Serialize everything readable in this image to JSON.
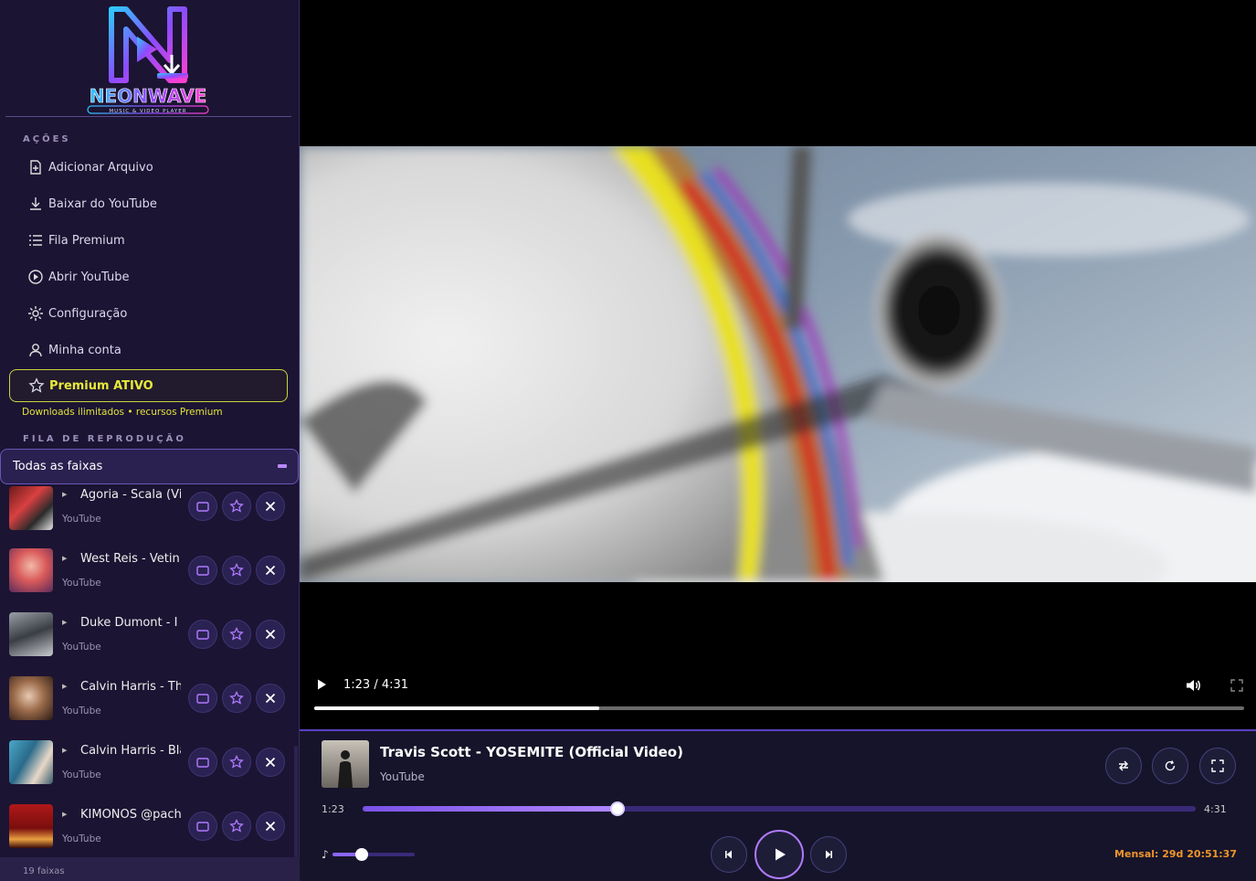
{
  "app": {
    "name": "NEONWAVE",
    "tagline": "MUSIC & VIDEO PLAYER"
  },
  "sidebar": {
    "actions_title": "AÇÕES",
    "actions": [
      {
        "label": "Adicionar Arquivo",
        "icon": "add-file-icon"
      },
      {
        "label": "Baixar do YouTube",
        "icon": "download-icon"
      },
      {
        "label": "Fila Premium",
        "icon": "list-icon"
      },
      {
        "label": "Abrir YouTube",
        "icon": "play-circle-icon"
      },
      {
        "label": "Configuração",
        "icon": "gear-icon"
      },
      {
        "label": "Minha conta",
        "icon": "user-icon"
      }
    ],
    "premium": {
      "label": "Premium ATIVO",
      "subtitle": "Downloads ilimitados • recursos Premium"
    },
    "queue_title": "FILA DE REPRODUÇÃO",
    "queue_filter": "Todas as faixas",
    "tracks": [
      {
        "title": "Agoria - Scala (Vin",
        "source": "YouTube"
      },
      {
        "title": "West Reis - Vetin",
        "source": "YouTube"
      },
      {
        "title": "Duke Dumont - I G",
        "source": "YouTube"
      },
      {
        "title": "Calvin Harris - Thir",
        "source": "YouTube"
      },
      {
        "title": "Calvin Harris - Blar",
        "source": "YouTube"
      },
      {
        "title": "KIMONOS @pacha",
        "source": "YouTube"
      }
    ],
    "track_count": "19 faixas"
  },
  "video": {
    "time": "1:23 / 4:31",
    "progress": 0.306
  },
  "player": {
    "title": "Travis Scott - YOSEMITE (Official Video)",
    "source": "YouTube",
    "current": "1:23",
    "total": "4:31",
    "progress": 0.306,
    "volume": 0.35,
    "subscription": "Mensal: 29d 20:51:37"
  },
  "colors": {
    "accent": "#b07bff",
    "premium": "#e8ea3a",
    "timer": "#f0952a"
  }
}
